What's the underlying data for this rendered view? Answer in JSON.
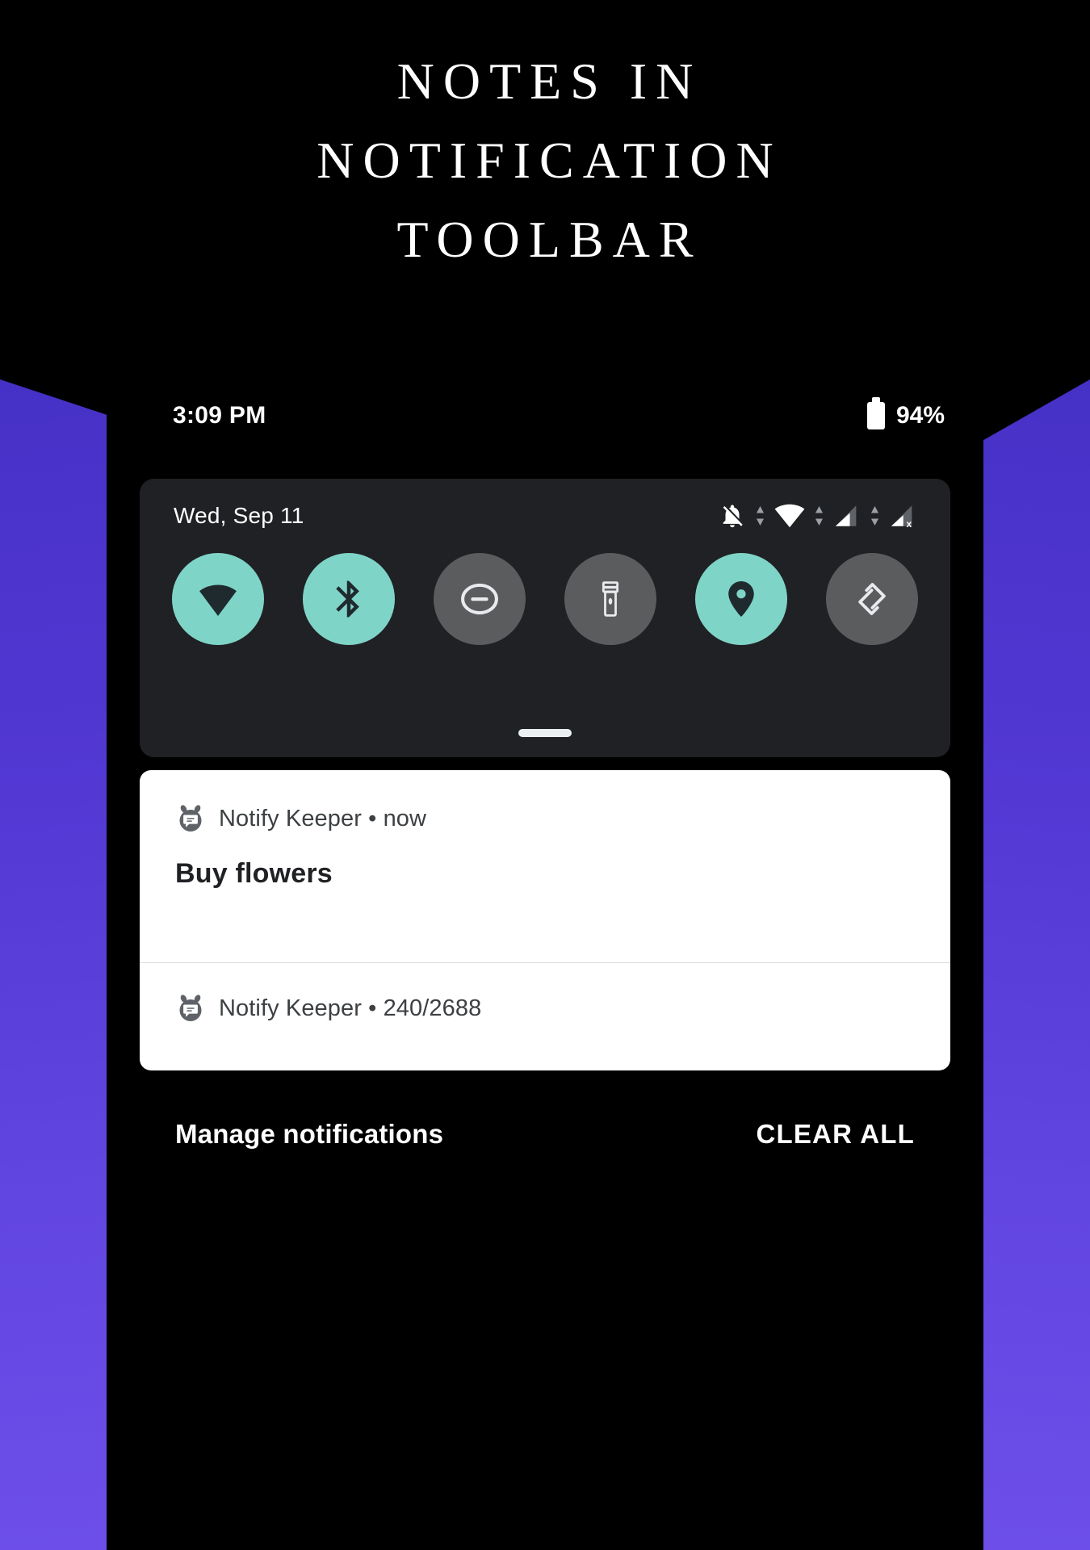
{
  "headline": {
    "line1": "NOTES IN",
    "line2": "NOTIFICATION",
    "line3": "TOOLBAR"
  },
  "colors": {
    "accent_teal": "#7fd4c8",
    "tile_off": "#5a5c5e",
    "panel_bg": "#202124",
    "purple_start": "#4631c6",
    "purple_end": "#6d4ee8",
    "card_bg": "#ffffff",
    "screen_bg": "#000000"
  },
  "status_bar": {
    "clock": "3:09 PM",
    "battery_percent": "94%",
    "battery_icon": "battery-full-icon"
  },
  "quick_settings": {
    "date": "Wed, Sep 11",
    "status_icons": [
      "notifications-off-icon",
      "data-transfer-arrows-icon",
      "wifi-full-icon",
      "data-transfer-arrows-icon",
      "signal-bars-icon",
      "data-transfer-arrows-icon",
      "signal-no-service-icon"
    ],
    "tiles": [
      {
        "name": "wifi",
        "icon": "wifi-icon",
        "state": "on"
      },
      {
        "name": "bluetooth",
        "icon": "bluetooth-icon",
        "state": "on"
      },
      {
        "name": "do-not-disturb",
        "icon": "do-not-disturb-icon",
        "state": "off"
      },
      {
        "name": "flashlight",
        "icon": "flashlight-icon",
        "state": "off"
      },
      {
        "name": "location",
        "icon": "location-pin-icon",
        "state": "on"
      },
      {
        "name": "auto-rotate",
        "icon": "auto-rotate-icon",
        "state": "off"
      }
    ],
    "drag_handle": "drag-handle"
  },
  "notifications": [
    {
      "app_name": "Notify Keeper",
      "separator": "•",
      "time": "now",
      "meta": "Notify Keeper • now",
      "title": "Buy flowers"
    },
    {
      "app_name": "Notify Keeper",
      "separator": "•",
      "time": "240/2688",
      "meta": "Notify Keeper • 240/2688",
      "title": ""
    }
  ],
  "footer": {
    "manage_label": "Manage notifications",
    "clear_label": "CLEAR ALL"
  }
}
